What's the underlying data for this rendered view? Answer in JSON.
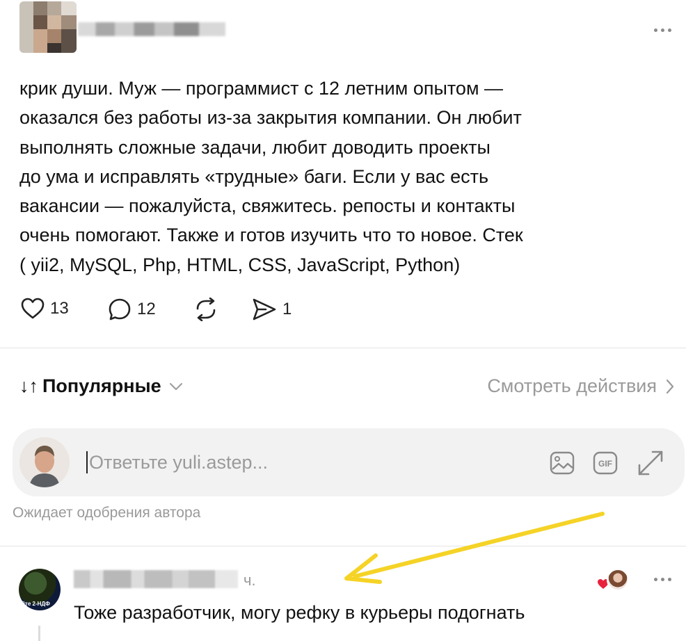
{
  "post": {
    "text_lines": [
      "крик души. Муж — программист с 12 летним опытом —",
      "оказался без работы из-за закрытия компании. Он любит",
      "выполнять сложные задачи, любит доводить проекты",
      "до ума и исправлять «трудные» баги. Если у вас есть",
      "вакансии — пожалуйста, свяжитесь. репосты и контакты",
      "очень помогают. Также и готов изучить что то новое. Стек",
      "( yii2, MySQL, Php, HTML, CSS, JavaScript, Python)"
    ],
    "likes": "13",
    "comments": "12",
    "shares": "1",
    "icons": [
      "heart-icon",
      "comment-icon",
      "repost-icon",
      "send-icon",
      "more-icon"
    ]
  },
  "sort": {
    "arrows": "↓↑",
    "label": "Популярные",
    "activity_link": "Смотреть действия"
  },
  "reply": {
    "placeholder": "Ответьте yuli.astep...",
    "pending": "Ожидает одобрения автора",
    "icons": [
      "image-icon",
      "gif-icon",
      "expand-icon"
    ]
  },
  "comment": {
    "time": "ч.",
    "text": "Тоже разработчик, могу рефку в курьеры подогнать",
    "avatar_caption": "йте 2-НДФ"
  },
  "colors": {
    "arrow": "#F5D327",
    "like_heart": "#E8223C",
    "muted_text": "#9A9A9A",
    "reply_bg": "#F2F2F2"
  }
}
